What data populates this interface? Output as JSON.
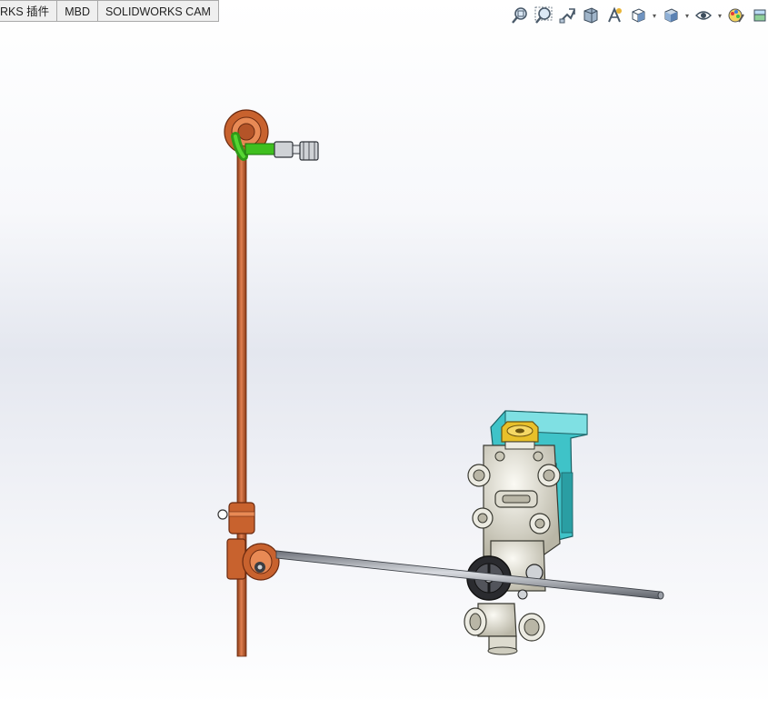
{
  "tabs": [
    "RKS 插件",
    "MBD",
    "SOLIDWORKS CAM"
  ],
  "toolbar": {
    "buttons": [
      {
        "icon": "zoom-to-fit-icon",
        "dropdown": false
      },
      {
        "icon": "zoom-to-area-icon",
        "dropdown": false
      },
      {
        "icon": "previous-view-icon",
        "dropdown": false
      },
      {
        "icon": "section-view-icon",
        "dropdown": false
      },
      {
        "icon": "dynamic-annotation-views-icon",
        "dropdown": false
      },
      {
        "icon": "view-orientation-icon",
        "dropdown": true
      },
      {
        "icon": "display-style-icon",
        "dropdown": true
      },
      {
        "icon": "hide-show-items-icon",
        "dropdown": true
      },
      {
        "icon": "edit-appearance-icon",
        "dropdown": false
      },
      {
        "icon": "apply-scene-icon",
        "dropdown": false
      }
    ]
  },
  "colors": {
    "copper": "#c8622e",
    "copper_dark": "#8a3a16",
    "fitting_green": "#3fbf1f",
    "bracket_teal": "#3fc3c8",
    "cap_gold": "#e8c02a",
    "valve_body": "#e6e4d8",
    "rod_gray": "#9a9ea6"
  }
}
